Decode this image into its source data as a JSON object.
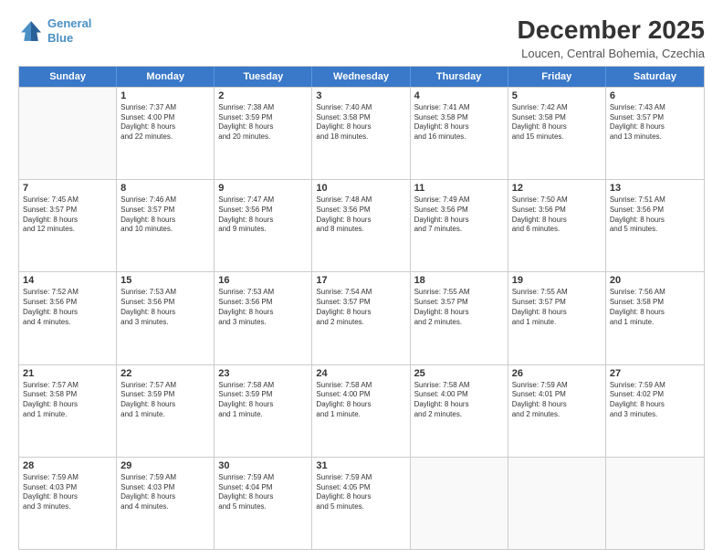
{
  "logo": {
    "line1": "General",
    "line2": "Blue"
  },
  "header": {
    "month": "December 2025",
    "location": "Loucen, Central Bohemia, Czechia"
  },
  "weekdays": [
    "Sunday",
    "Monday",
    "Tuesday",
    "Wednesday",
    "Thursday",
    "Friday",
    "Saturday"
  ],
  "weeks": [
    [
      {
        "day": "",
        "lines": []
      },
      {
        "day": "1",
        "lines": [
          "Sunrise: 7:37 AM",
          "Sunset: 4:00 PM",
          "Daylight: 8 hours",
          "and 22 minutes."
        ]
      },
      {
        "day": "2",
        "lines": [
          "Sunrise: 7:38 AM",
          "Sunset: 3:59 PM",
          "Daylight: 8 hours",
          "and 20 minutes."
        ]
      },
      {
        "day": "3",
        "lines": [
          "Sunrise: 7:40 AM",
          "Sunset: 3:58 PM",
          "Daylight: 8 hours",
          "and 18 minutes."
        ]
      },
      {
        "day": "4",
        "lines": [
          "Sunrise: 7:41 AM",
          "Sunset: 3:58 PM",
          "Daylight: 8 hours",
          "and 16 minutes."
        ]
      },
      {
        "day": "5",
        "lines": [
          "Sunrise: 7:42 AM",
          "Sunset: 3:58 PM",
          "Daylight: 8 hours",
          "and 15 minutes."
        ]
      },
      {
        "day": "6",
        "lines": [
          "Sunrise: 7:43 AM",
          "Sunset: 3:57 PM",
          "Daylight: 8 hours",
          "and 13 minutes."
        ]
      }
    ],
    [
      {
        "day": "7",
        "lines": [
          "Sunrise: 7:45 AM",
          "Sunset: 3:57 PM",
          "Daylight: 8 hours",
          "and 12 minutes."
        ]
      },
      {
        "day": "8",
        "lines": [
          "Sunrise: 7:46 AM",
          "Sunset: 3:57 PM",
          "Daylight: 8 hours",
          "and 10 minutes."
        ]
      },
      {
        "day": "9",
        "lines": [
          "Sunrise: 7:47 AM",
          "Sunset: 3:56 PM",
          "Daylight: 8 hours",
          "and 9 minutes."
        ]
      },
      {
        "day": "10",
        "lines": [
          "Sunrise: 7:48 AM",
          "Sunset: 3:56 PM",
          "Daylight: 8 hours",
          "and 8 minutes."
        ]
      },
      {
        "day": "11",
        "lines": [
          "Sunrise: 7:49 AM",
          "Sunset: 3:56 PM",
          "Daylight: 8 hours",
          "and 7 minutes."
        ]
      },
      {
        "day": "12",
        "lines": [
          "Sunrise: 7:50 AM",
          "Sunset: 3:56 PM",
          "Daylight: 8 hours",
          "and 6 minutes."
        ]
      },
      {
        "day": "13",
        "lines": [
          "Sunrise: 7:51 AM",
          "Sunset: 3:56 PM",
          "Daylight: 8 hours",
          "and 5 minutes."
        ]
      }
    ],
    [
      {
        "day": "14",
        "lines": [
          "Sunrise: 7:52 AM",
          "Sunset: 3:56 PM",
          "Daylight: 8 hours",
          "and 4 minutes."
        ]
      },
      {
        "day": "15",
        "lines": [
          "Sunrise: 7:53 AM",
          "Sunset: 3:56 PM",
          "Daylight: 8 hours",
          "and 3 minutes."
        ]
      },
      {
        "day": "16",
        "lines": [
          "Sunrise: 7:53 AM",
          "Sunset: 3:56 PM",
          "Daylight: 8 hours",
          "and 3 minutes."
        ]
      },
      {
        "day": "17",
        "lines": [
          "Sunrise: 7:54 AM",
          "Sunset: 3:57 PM",
          "Daylight: 8 hours",
          "and 2 minutes."
        ]
      },
      {
        "day": "18",
        "lines": [
          "Sunrise: 7:55 AM",
          "Sunset: 3:57 PM",
          "Daylight: 8 hours",
          "and 2 minutes."
        ]
      },
      {
        "day": "19",
        "lines": [
          "Sunrise: 7:55 AM",
          "Sunset: 3:57 PM",
          "Daylight: 8 hours",
          "and 1 minute."
        ]
      },
      {
        "day": "20",
        "lines": [
          "Sunrise: 7:56 AM",
          "Sunset: 3:58 PM",
          "Daylight: 8 hours",
          "and 1 minute."
        ]
      }
    ],
    [
      {
        "day": "21",
        "lines": [
          "Sunrise: 7:57 AM",
          "Sunset: 3:58 PM",
          "Daylight: 8 hours",
          "and 1 minute."
        ]
      },
      {
        "day": "22",
        "lines": [
          "Sunrise: 7:57 AM",
          "Sunset: 3:59 PM",
          "Daylight: 8 hours",
          "and 1 minute."
        ]
      },
      {
        "day": "23",
        "lines": [
          "Sunrise: 7:58 AM",
          "Sunset: 3:59 PM",
          "Daylight: 8 hours",
          "and 1 minute."
        ]
      },
      {
        "day": "24",
        "lines": [
          "Sunrise: 7:58 AM",
          "Sunset: 4:00 PM",
          "Daylight: 8 hours",
          "and 1 minute."
        ]
      },
      {
        "day": "25",
        "lines": [
          "Sunrise: 7:58 AM",
          "Sunset: 4:00 PM",
          "Daylight: 8 hours",
          "and 2 minutes."
        ]
      },
      {
        "day": "26",
        "lines": [
          "Sunrise: 7:59 AM",
          "Sunset: 4:01 PM",
          "Daylight: 8 hours",
          "and 2 minutes."
        ]
      },
      {
        "day": "27",
        "lines": [
          "Sunrise: 7:59 AM",
          "Sunset: 4:02 PM",
          "Daylight: 8 hours",
          "and 3 minutes."
        ]
      }
    ],
    [
      {
        "day": "28",
        "lines": [
          "Sunrise: 7:59 AM",
          "Sunset: 4:03 PM",
          "Daylight: 8 hours",
          "and 3 minutes."
        ]
      },
      {
        "day": "29",
        "lines": [
          "Sunrise: 7:59 AM",
          "Sunset: 4:03 PM",
          "Daylight: 8 hours",
          "and 4 minutes."
        ]
      },
      {
        "day": "30",
        "lines": [
          "Sunrise: 7:59 AM",
          "Sunset: 4:04 PM",
          "Daylight: 8 hours",
          "and 5 minutes."
        ]
      },
      {
        "day": "31",
        "lines": [
          "Sunrise: 7:59 AM",
          "Sunset: 4:05 PM",
          "Daylight: 8 hours",
          "and 5 minutes."
        ]
      },
      {
        "day": "",
        "lines": []
      },
      {
        "day": "",
        "lines": []
      },
      {
        "day": "",
        "lines": []
      }
    ]
  ]
}
